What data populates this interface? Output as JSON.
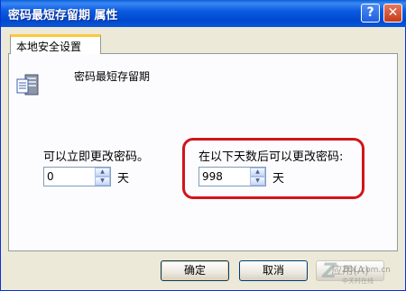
{
  "window": {
    "title": "密码最短存留期 属性",
    "help_glyph": "?",
    "close_glyph": "✕"
  },
  "tabs": [
    {
      "label": "本地安全设置",
      "active": true
    }
  ],
  "policy": {
    "name": "密码最短存留期",
    "icon": "server-policy-icon"
  },
  "option_immediate": {
    "label": "可以立即更改密码。",
    "value": "0",
    "unit": "天"
  },
  "option_days": {
    "label": "在以下天数后可以更改密码:",
    "value": "998",
    "unit": "天"
  },
  "buttons": {
    "ok": "确定",
    "cancel": "取消",
    "apply": "应用(A)"
  },
  "watermark": {
    "logo": "Z",
    "url": "ZOL.com.cn",
    "subtitle": "中关村在线"
  },
  "colors": {
    "title_bar": "#0a5fd8",
    "highlight_border": "#d2141b",
    "tab_accent": "#ffc83c"
  }
}
